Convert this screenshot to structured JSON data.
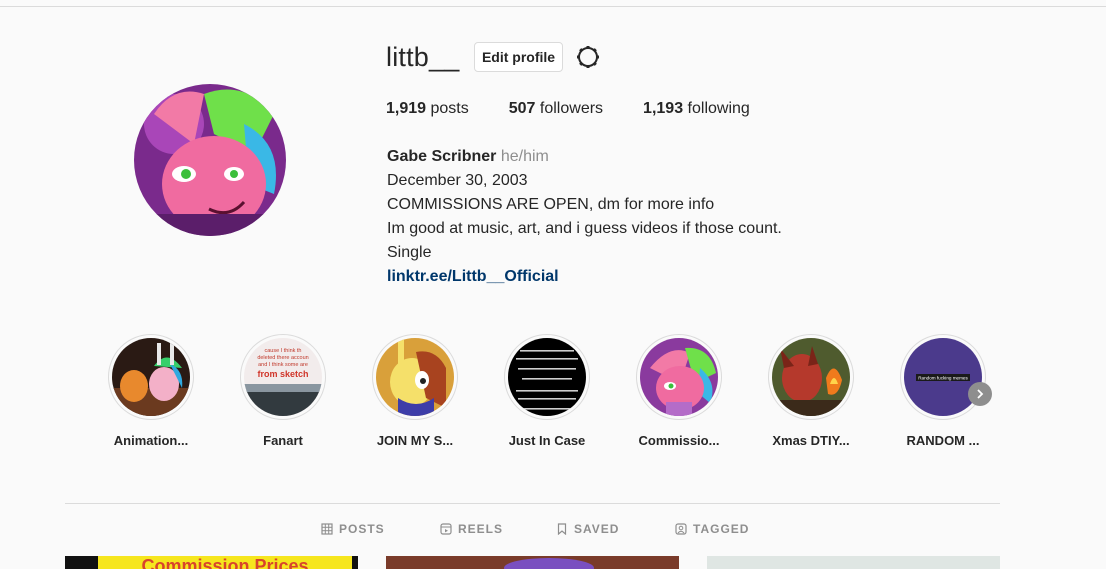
{
  "profile": {
    "username": "littb__",
    "edit_label": "Edit profile",
    "settings_icon": "gear-icon"
  },
  "stats": {
    "posts_count": "1,919",
    "posts_label": "posts",
    "followers_count": "507",
    "followers_label": "followers",
    "following_count": "1,193",
    "following_label": "following"
  },
  "bio": {
    "name": "Gabe Scribner",
    "pronouns": "he/him",
    "lines": [
      "December 30, 2003",
      "COMMISSIONS ARE OPEN, dm for more info",
      "Im good at music, art, and i guess videos if those count.",
      "Single"
    ],
    "link": "linktr.ee/Littb__Official"
  },
  "highlights": [
    {
      "label": "Animation..."
    },
    {
      "label": "Fanart",
      "thumb_text": [
        "cause I think th",
        "deleted there accoun",
        "and I think some are",
        "from sketch"
      ]
    },
    {
      "label": "JOIN MY S..."
    },
    {
      "label": "Just In Case"
    },
    {
      "label": "Commissio..."
    },
    {
      "label": "Xmas DTIY..."
    },
    {
      "label": "RANDOM ...",
      "thumb_text": [
        "Random fucking memes"
      ]
    }
  ],
  "tabs": [
    {
      "label": "POSTS",
      "icon": "grid-icon"
    },
    {
      "label": "REELS",
      "icon": "reels-icon"
    },
    {
      "label": "SAVED",
      "icon": "bookmark-icon"
    },
    {
      "label": "TAGGED",
      "icon": "tag-icon"
    }
  ],
  "posts": [
    {
      "text": "Commission Prices"
    },
    {
      "text": ""
    },
    {
      "text": ""
    }
  ]
}
